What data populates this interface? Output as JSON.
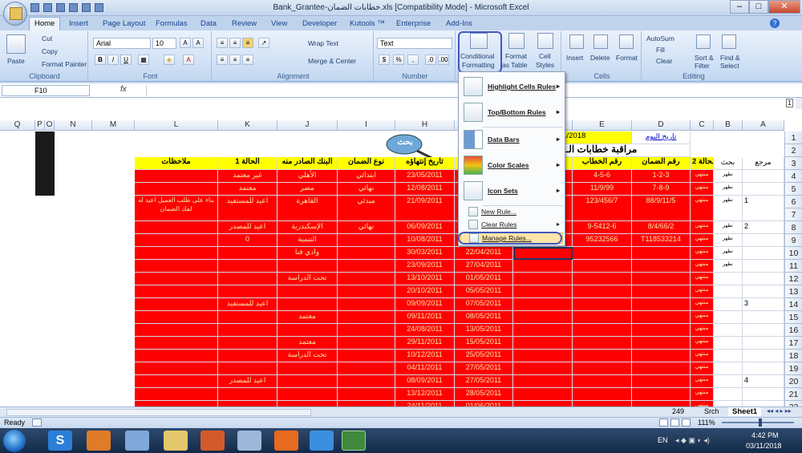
{
  "window": {
    "title": "Bank_Grantee-خطابات الضمان.xls  [Compatibility Mode] - Microsoft Excel"
  },
  "tabs": [
    "Home",
    "Insert",
    "Page Layout",
    "Formulas",
    "Data",
    "Review",
    "View",
    "Developer",
    "Kutools ™",
    "Enterprise",
    "Add-Ins"
  ],
  "ribbon": {
    "clipboard": {
      "label": "Clipboard",
      "paste": "Paste",
      "cut": "Cut",
      "copy": "Copy",
      "format_painter": "Format Painter"
    },
    "font": {
      "label": "Font",
      "name": "Arial",
      "size": "10"
    },
    "alignment": {
      "label": "Alignment",
      "wrap": "Wrap Text",
      "merge": "Merge & Center"
    },
    "number": {
      "label": "Number",
      "format": "Text"
    },
    "styles": {
      "cf1": "Conditional",
      "cf2": "Formatting",
      "fat1": "Format",
      "fat2": "as Table",
      "cs1": "Cell",
      "cs2": "Styles"
    },
    "cells": {
      "label": "Cells",
      "insert": "Insert",
      "delete": "Delete",
      "format": "Format"
    },
    "editing": {
      "label": "Editing",
      "autosum": "AutoSum",
      "fill": "Fill",
      "clear": "Clear",
      "sort1": "Sort &",
      "sort2": "Filter",
      "find1": "Find &",
      "find2": "Select"
    }
  },
  "formula_bar": {
    "name_box": "F10",
    "fx": "fx",
    "value": ""
  },
  "cf_menu": {
    "items": [
      "Highlight Cells Rules",
      "Top/Bottom Rules",
      "Data Bars",
      "Color Scales",
      "Icon Sets"
    ],
    "new_rule": "New Rule...",
    "clear_rules": "Clear Rules",
    "manage_rules": "Manage Rules..."
  },
  "columns": [
    "Q",
    "P",
    "O",
    "N",
    "M",
    "L",
    "K",
    "J",
    "I",
    "H",
    "G",
    "F",
    "E",
    "D",
    "C",
    "B",
    "A"
  ],
  "rows": [
    "1",
    "2",
    "3",
    "4",
    "5",
    "6",
    "7",
    "8",
    "9",
    "10",
    "11",
    "12",
    "13",
    "14",
    "15",
    "16",
    "17",
    "18",
    "19",
    "20",
    "21",
    "22",
    "23"
  ],
  "sheet": {
    "date_label": "تاريخ اليوم",
    "date_value": "11/2018",
    "title": "مراقبة خطابات الـ",
    "search": "بحث",
    "headers": {
      "L": "ملاحظات",
      "K": "الحالة 1",
      "J": "البنك الصادر منه",
      "I": "نوع الضمان",
      "H": "تاريخ إنتهاؤه",
      "E": "رقم الخطاب",
      "D": "رقم الضمان",
      "C": "الحالة 2",
      "B": "بحث",
      "A": "مرجع"
    },
    "data": [
      {
        "K": "غير معتمد",
        "J": "الأهلي",
        "I": "ابتدائي",
        "H": "23/05/2011",
        "E": "4-5-6",
        "D": "1-2-3"
      },
      {
        "K": "معتمد",
        "J": "مصر",
        "I": "نهائي",
        "H": "12/08/2011",
        "E": "11/9/99",
        "D": "7-8-9"
      },
      {
        "L": "بناء على طلب العميل اعيد له لفك الضمان",
        "K": "اعيد للمستفيد",
        "J": "القاهرة",
        "I": "مبدئي",
        "H": "21/09/2011",
        "E": "123/456/7",
        "D": "88/9/11/5",
        "A": "1"
      },
      {
        "K": "اعيد للمصدر",
        "J": "الإسكندرية",
        "I": "نهائي",
        "H": "06/09/2011",
        "E": "9-5412-6",
        "D": "8/4/66/2",
        "A": "2"
      },
      {
        "K": "تحت الدراسة",
        "J": "قناة السويس",
        "I": "نهائي",
        "H": "22/09/2011",
        "E": "991432",
        "D": "s99-1432"
      },
      {
        "K": "0",
        "J": "التنمية",
        "H": "10/08/2011",
        "G": "19/04/2011",
        "E": "95232566",
        "D": "T118533214"
      },
      {
        "J": "وادي فنا",
        "H": "30/03/2011",
        "G": "22/04/2011"
      },
      {
        "H": "23/09/2011",
        "G": "27/04/2011"
      },
      {
        "J": "تحت الدراسة",
        "H": "13/10/2011",
        "G": "01/05/2011"
      },
      {
        "H": "20/10/2011",
        "G": "05/05/2011"
      },
      {
        "K": "اعيد للمستفيد",
        "H": "09/09/2011",
        "G": "07/05/2011",
        "A": "3"
      },
      {
        "J": "معتمد",
        "H": "09/11/2011",
        "G": "08/05/2011"
      },
      {
        "H": "24/08/2011",
        "G": "13/05/2011"
      },
      {
        "J": "معتمد",
        "H": "29/11/2011",
        "G": "15/05/2011"
      },
      {
        "J": "تحت الدراسة",
        "H": "10/12/2011",
        "G": "25/05/2011"
      },
      {
        "H": "04/11/2011",
        "G": "27/05/2011"
      },
      {
        "K": "اعيد للمصدر",
        "H": "08/09/2011",
        "G": "27/05/2011",
        "A": "4"
      },
      {
        "H": "13/12/2011",
        "G": "28/05/2011"
      },
      {
        "H": "24/11/2011",
        "G": "01/06/2011"
      },
      {
        "J": "غير معتمد",
        "H": "10/09/2011",
        "G": "03/06/2011"
      }
    ],
    "c_value": "منتهي",
    "b_values": [
      "تظهر",
      "تظهر",
      "تظهر",
      "تظهر",
      "تظهر",
      "تظهر",
      "تظهر",
      "تظهر"
    ]
  },
  "sheet_tabs": {
    "tab1": "Sheet1",
    "t2": "Srch",
    "t3": "249"
  },
  "status": {
    "ready": "Ready",
    "zoom": "111%"
  },
  "taskbar": {
    "lang": "EN",
    "time": "4:42 PM",
    "date": "03/11/2018"
  }
}
